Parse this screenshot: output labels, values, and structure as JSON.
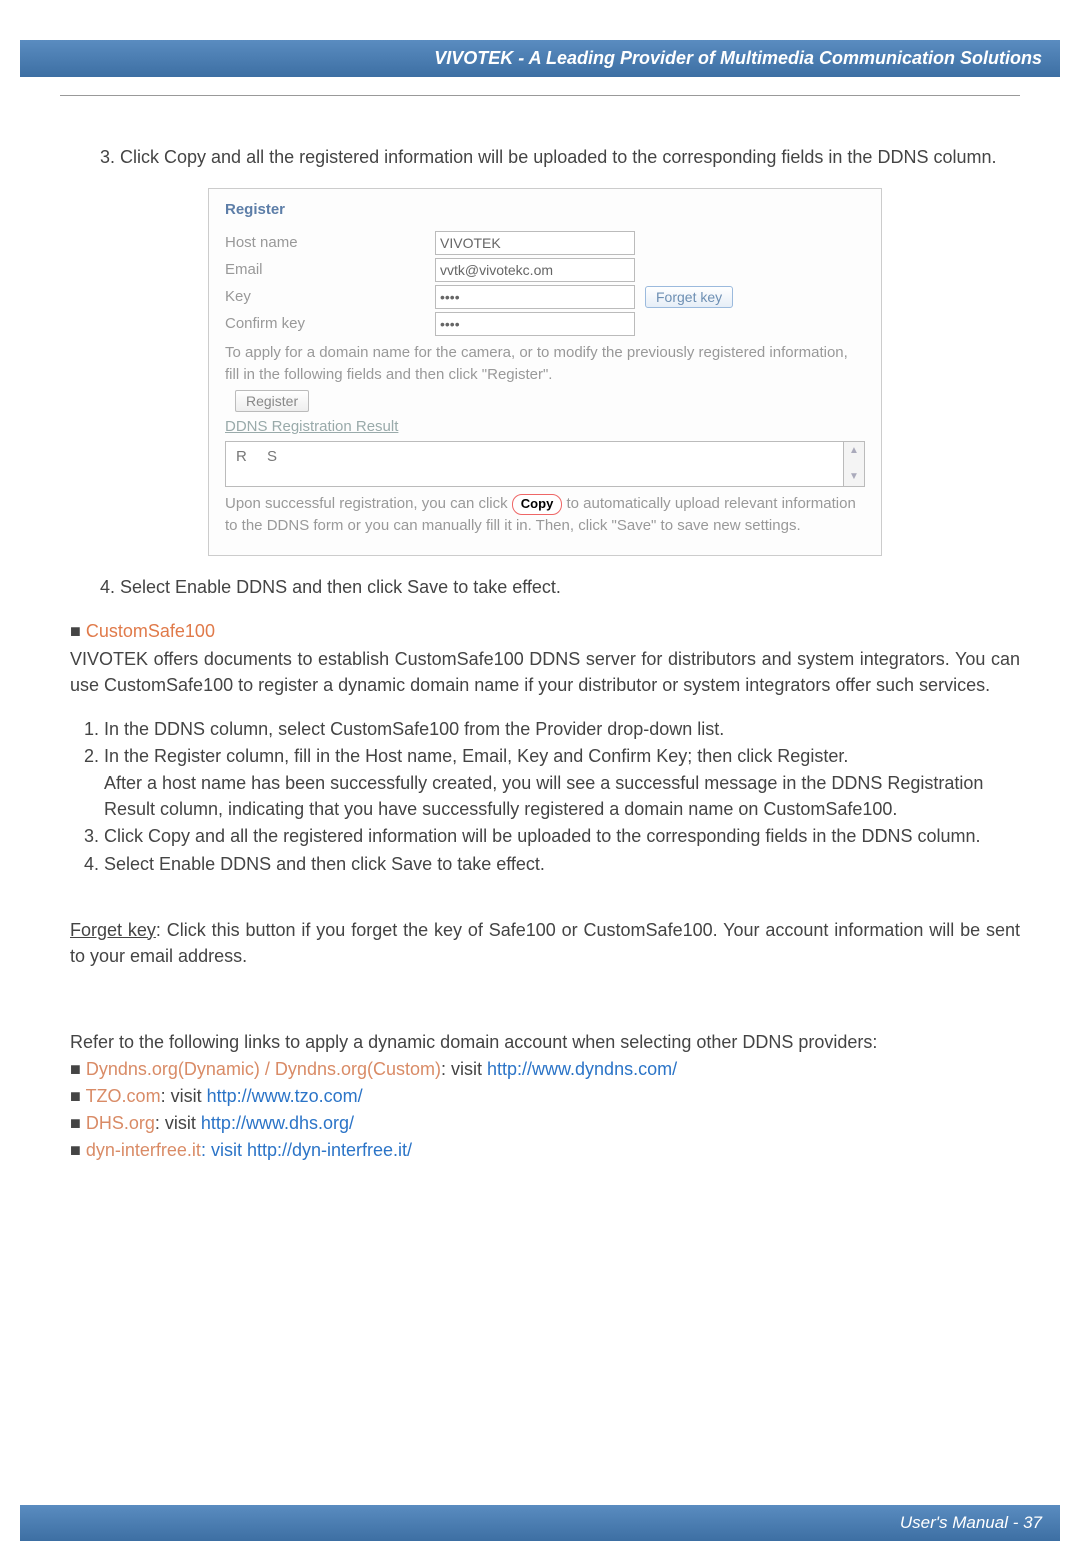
{
  "header": {
    "title": "VIVOTEK - A Leading Provider of Multimedia Communication Solutions"
  },
  "step3": "3. Click Copy and all the registered information will be uploaded to the corresponding fields in the DDNS column.",
  "register": {
    "title": "Register",
    "hostname_label": "Host name",
    "hostname_value": "VIVOTEK",
    "email_label": "Email",
    "email_value": "vvtk@vivotekc.om",
    "key_label": "Key",
    "key_value": "••••",
    "forget_label": "Forget key",
    "confirm_label": "Confirm key",
    "confirm_value": "••••",
    "apply_text": "To apply for a domain name for the camera, or to modify the previously registered information, fill in the following fields and then click \"Register\".",
    "register_btn": "Register",
    "result_label": "DDNS Registration Result",
    "result_value": "R   S",
    "upon_text_1": "Upon successful registration, you can click ",
    "copy_label": "Copy",
    "upon_text_2": " to automatically upload relevant information to the DDNS form or you can manually fill it in. Then, click \"Save\" to save new settings."
  },
  "step4": "4. Select Enable DDNS and then click Save to take effect.",
  "custom": {
    "heading_prefix": "■ ",
    "heading": "CustomSafe100",
    "p1": "VIVOTEK offers documents to establish CustomSafe100 DDNS server for distributors and system integrators. You can use CustomSafe100 to register a dynamic domain name if your distributor or system integrators offer such services.",
    "li1": "1. In the DDNS column, select CustomSafe100 from the Provider drop-down list.",
    "li2a": "2. In the Register column, fill in the Host name, Email, Key and Confirm Key; then click Register.",
    "li2b": "After a host name has been successfully created, you will see a successful message in the DDNS Registration Result column, indicating that you have successfully registered a domain name on CustomSafe100.",
    "li3": "3. Click Copy and all the registered information will be uploaded to the corresponding fields in the DDNS column.",
    "li4": "4. Select Enable DDNS and then click Save to take effect."
  },
  "forget": {
    "label": "Forget key",
    "text": ": Click this button if you forget the key of Safe100 or CustomSafe100. Your account information will be sent to your email address."
  },
  "providers": {
    "intro": "Refer to the following links to apply a dynamic domain account when selecting other DDNS providers:",
    "p1": {
      "prefix": "■ ",
      "name": "Dyndns.org(Dynamic) / Dyndns.org(Custom)",
      "visit": ": visit ",
      "url": "http://www.dyndns.com/"
    },
    "p2": {
      "prefix": "■ ",
      "name": "TZO.com",
      "visit": ": visit ",
      "url": "http://www.tzo.com/"
    },
    "p3": {
      "prefix": "■ ",
      "name": "DHS.org",
      "visit": ": visit ",
      "url": "http://www.dhs.org/"
    },
    "p4": {
      "prefix": "■ ",
      "name": "dyn-interfree.it",
      "visit": ": visit ",
      "url": "http://dyn-interfree.it/"
    }
  },
  "footer": {
    "text": "User's Manual - 37"
  }
}
